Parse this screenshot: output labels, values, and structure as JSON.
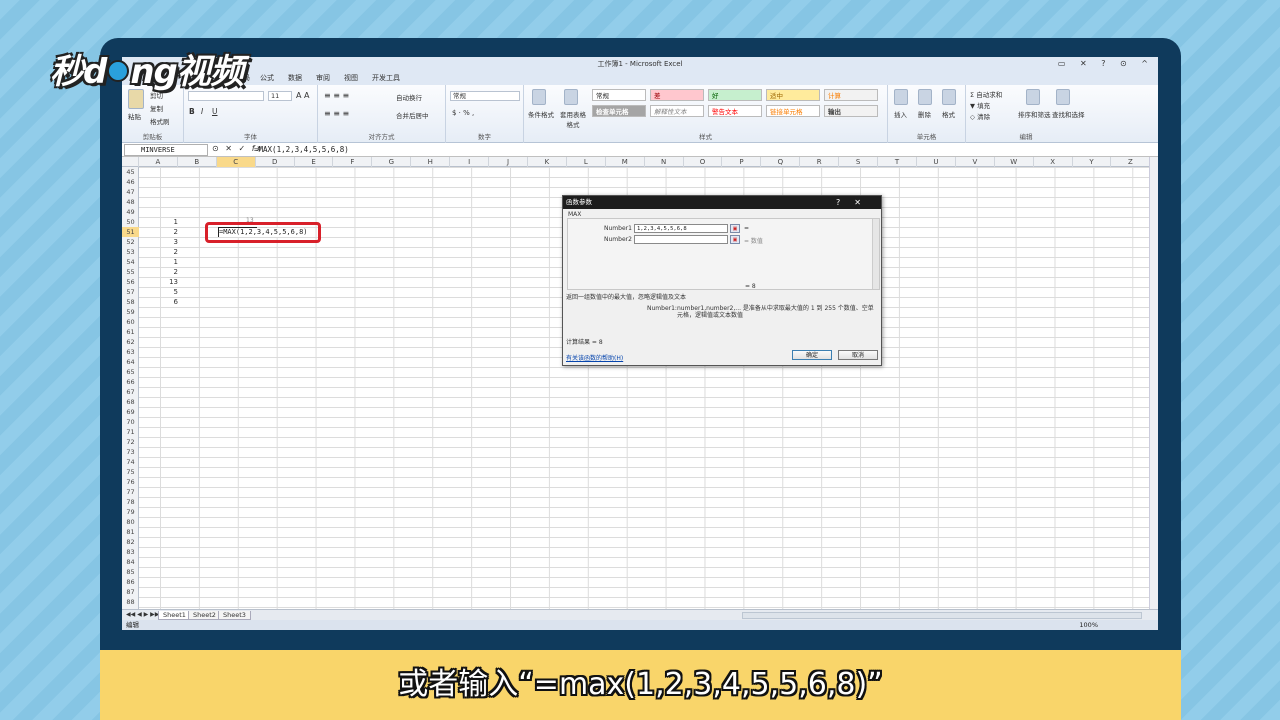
{
  "brand": {
    "logo_part1": "秒d",
    "logo_part2": "ng视频"
  },
  "caption": "或者输入“=max(1,2,3,4,5,5,6,8)”",
  "excel": {
    "window_title": "工作簿1 - Microsoft Excel",
    "tabs": [
      "页面布局",
      "公式",
      "数据",
      "审阅",
      "视图",
      "开发工具"
    ],
    "ribbon": {
      "clipboard": {
        "paste": "粘贴",
        "cut": "剪切",
        "copy": "复制",
        "format_painter": "格式刷",
        "label": "剪贴板"
      },
      "font": {
        "size": "11",
        "bold": "B",
        "italic": "I",
        "underline": "U",
        "label": "字体"
      },
      "alignment": {
        "wrap": "自动换行",
        "merge": "合并后居中",
        "label": "对齐方式"
      },
      "number": {
        "format": "常规",
        "label": "数字"
      },
      "styles": {
        "conditional": "条件格式",
        "table_format": "套用表格格式",
        "normal": "常规",
        "bad": "差",
        "good": "好",
        "neutral": "适中",
        "calculation": "计算",
        "check_cell": "检查单元格",
        "explanatory": "解释性文本",
        "warning": "警告文本",
        "linked": "链接单元格",
        "output": "输出",
        "label": "样式"
      },
      "cells": {
        "insert": "插入",
        "delete": "删除",
        "format": "格式",
        "label": "单元格"
      },
      "editing": {
        "autosum": "自动求和",
        "fill": "填充",
        "clear": "清除",
        "sort": "排序和筛选",
        "find": "查找和选择",
        "label": "编辑"
      }
    },
    "name_box": "MINVERSE",
    "formula_bar": "=MAX(1,2,3,4,5,5,6,8)",
    "columns": [
      "A",
      "B",
      "C",
      "D",
      "E",
      "F",
      "G",
      "H",
      "I",
      "J",
      "K",
      "L",
      "M",
      "N",
      "O",
      "P",
      "Q",
      "R",
      "S",
      "T",
      "U",
      "V",
      "W",
      "X",
      "Y",
      "Z"
    ],
    "rows": [
      "45",
      "46",
      "47",
      "48",
      "49",
      "50",
      "51",
      "52",
      "53",
      "54",
      "55",
      "56",
      "57",
      "58",
      "59",
      "60",
      "61",
      "62",
      "63",
      "64",
      "65",
      "66",
      "67",
      "68",
      "69",
      "70",
      "71",
      "72",
      "73",
      "74",
      "75",
      "76",
      "77",
      "78",
      "79",
      "80",
      "81",
      "82",
      "83",
      "84",
      "85",
      "86",
      "87",
      "88"
    ],
    "column_a_values": [
      "1",
      "2",
      "3",
      "2",
      "1",
      "2",
      "13",
      "5",
      "6"
    ],
    "edit_cell_text": "=MAX(1,2,3,4,5,5,6,8)",
    "tooltip_value": "13",
    "sheets": [
      "Sheet1",
      "Sheet2",
      "Sheet3"
    ],
    "status": "编辑",
    "zoom": "100%"
  },
  "dialog": {
    "title": "函数参数",
    "help_btn": "?",
    "close_btn": "✕",
    "function_name": "MAX",
    "arg1_label": "Number1",
    "arg1_value": "1,2,3,4,5,5,6,8",
    "arg1_result": "=",
    "arg2_label": "Number2",
    "arg2_result": "= 数值",
    "overall_result": "= 8",
    "description": "返回一组数值中的最大值，忽略逻辑值及文本",
    "arg_desc_name": "Number1:",
    "arg_desc_text": "number1,number2,... 是准备从中求取最大值的 1 到 255 个数值、空单元格，逻辑值或文本数值",
    "result_text": "计算结果 = 8",
    "help_link": "有关该函数的帮助(H)",
    "ok": "确定",
    "cancel": "取消"
  }
}
